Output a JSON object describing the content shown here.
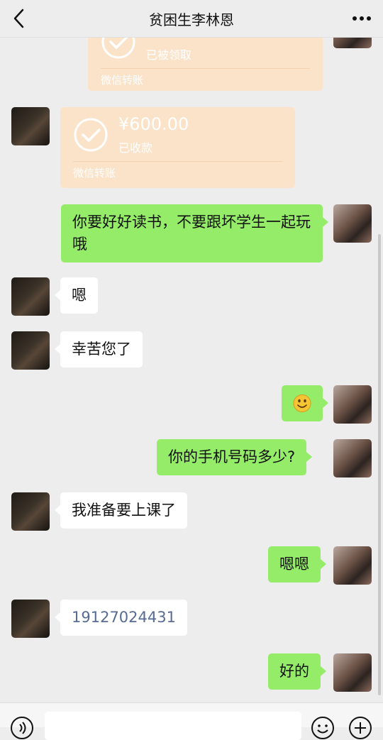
{
  "header": {
    "title": "贫困生李林恩"
  },
  "transfers": [
    {
      "amount": "",
      "status": "已被领取",
      "label": "微信转账"
    },
    {
      "amount": "¥600.00",
      "status": "已收款",
      "label": "微信转账"
    }
  ],
  "messages": [
    {
      "side": "out",
      "text": "你要好好读书，不要跟坏学生一起玩哦"
    },
    {
      "side": "in",
      "text": "嗯"
    },
    {
      "side": "in",
      "text": "幸苦您了"
    },
    {
      "side": "out",
      "emoji": "smile"
    },
    {
      "side": "out",
      "text": "你的手机号码多少?"
    },
    {
      "side": "in",
      "text": "我准备要上课了"
    },
    {
      "side": "out",
      "text": "嗯嗯"
    },
    {
      "side": "in",
      "text": "19127024431"
    },
    {
      "side": "out",
      "text": "好的"
    }
  ],
  "colors": {
    "outgoing_bubble": "#95ec69",
    "incoming_bubble": "#ffffff",
    "transfer_card": "#fbe3c9",
    "background": "#ededed"
  },
  "icons": [
    "back-arrow-icon",
    "more-dots-icon",
    "check-circle-icon",
    "smile-emoji-icon",
    "voice-icon",
    "emoji-icon",
    "plus-icon"
  ]
}
